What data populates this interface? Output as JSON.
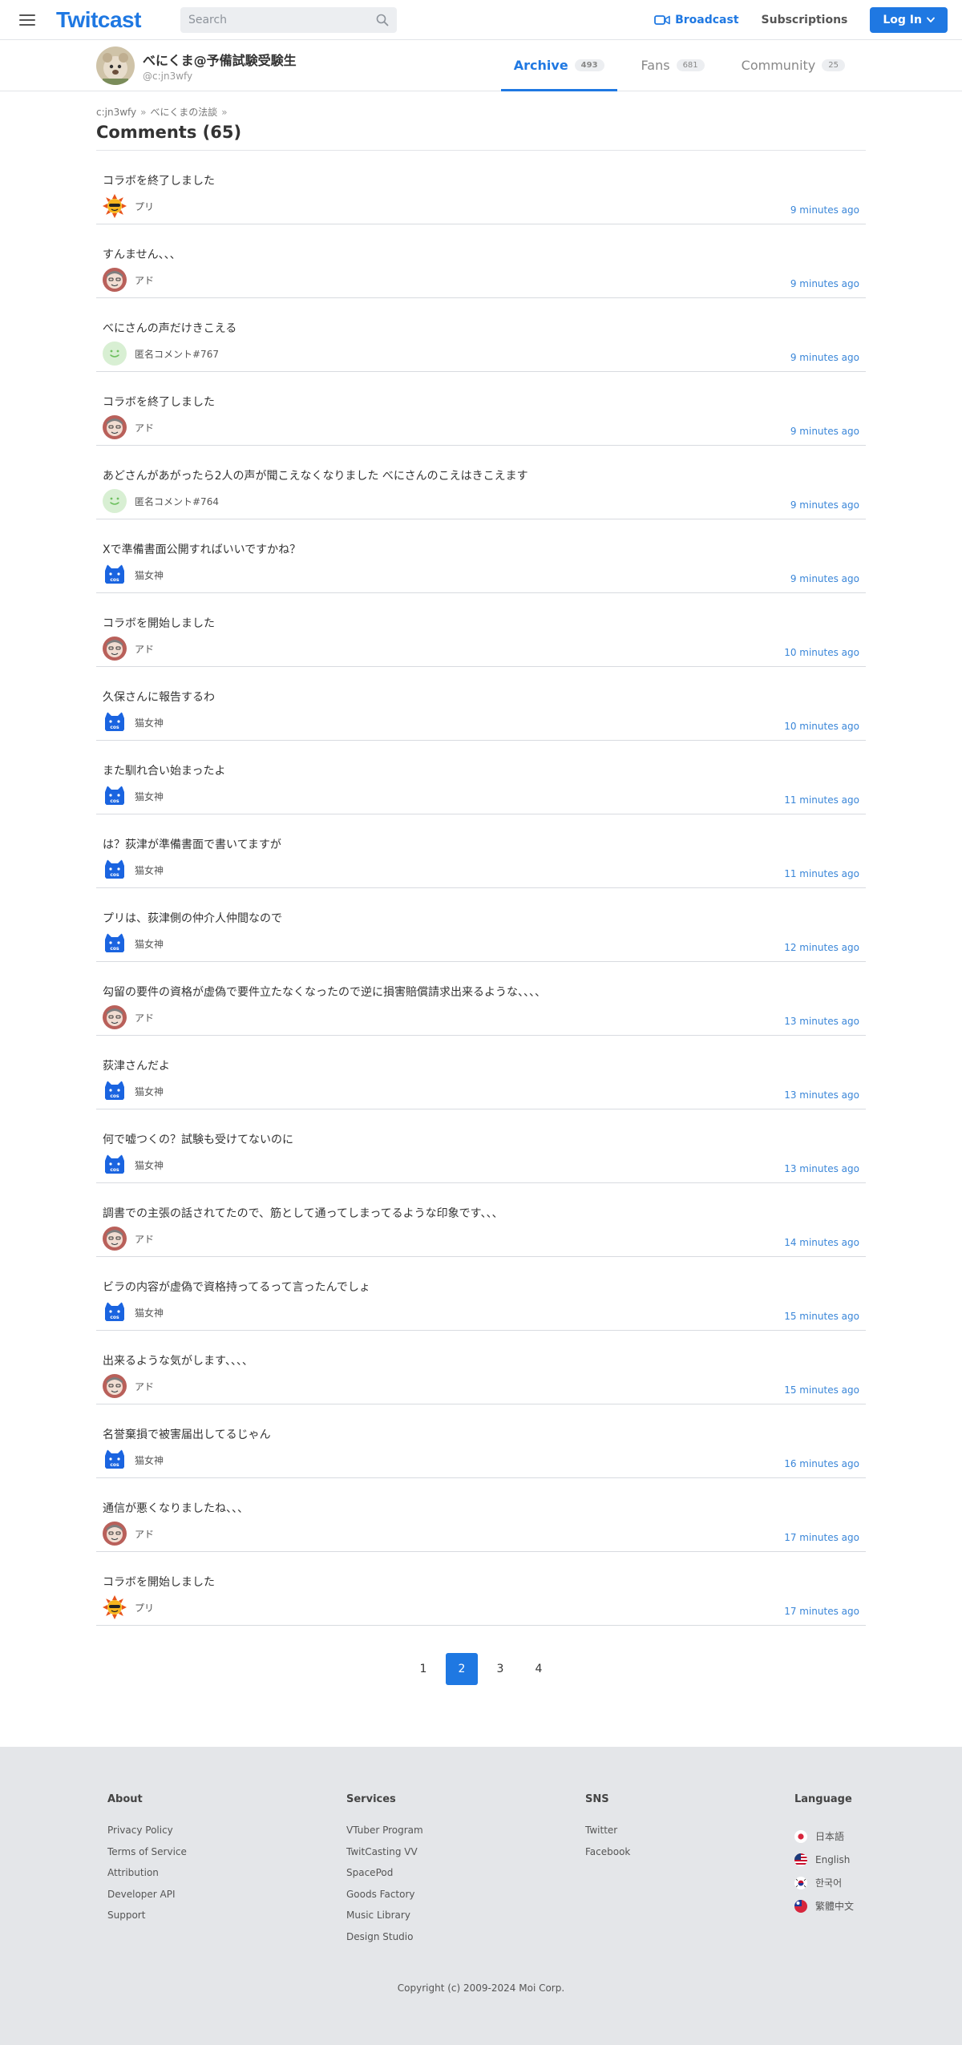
{
  "header": {
    "logo": "Twitcast",
    "search_placeholder": "Search",
    "broadcast_label": "Broadcast",
    "subscriptions_label": "Subscriptions",
    "login_label": "Log In",
    "accent_color": "#1f78e2"
  },
  "profile": {
    "name": "べにくま@予備試験受験生",
    "id": "@c:jn3wfy",
    "tabs": [
      {
        "label": "Archive",
        "count": "493",
        "active": true
      },
      {
        "label": "Fans",
        "count": "681",
        "active": false
      },
      {
        "label": "Community",
        "count": "25",
        "active": false
      }
    ]
  },
  "breadcrumb": [
    "c:jn3wfy",
    "べにくまの法談"
  ],
  "page_title": "Comments (65)",
  "comments": [
    {
      "text": "コラボを終了しました",
      "user": "プリ",
      "avatar": "sun-avatar",
      "time": "9 minutes ago"
    },
    {
      "text": "すんません、、、",
      "user": "アド",
      "avatar": "face-avatar",
      "time": "9 minutes ago"
    },
    {
      "text": "べにさんの声だけきこえる",
      "user": "匿名コメント#767",
      "avatar": "anon-avatar",
      "time": "9 minutes ago"
    },
    {
      "text": "コラボを終了しました",
      "user": "アド",
      "avatar": "face-avatar",
      "time": "9 minutes ago"
    },
    {
      "text": "あどさんがあがったら2人の声が聞こえなくなりました べにさんのこえはきこえます",
      "user": "匿名コメント#764",
      "avatar": "anon-avatar",
      "time": "9 minutes ago"
    },
    {
      "text": "Xで準備書面公開すればいいですかね？",
      "user": "猫女神",
      "avatar": "cat-avatar",
      "time": "9 minutes ago"
    },
    {
      "text": "コラボを開始しました",
      "user": "アド",
      "avatar": "face-avatar",
      "time": "10 minutes ago"
    },
    {
      "text": "久保さんに報告するわ",
      "user": "猫女神",
      "avatar": "cat-avatar",
      "time": "10 minutes ago"
    },
    {
      "text": "また馴れ合い始まったよ",
      "user": "猫女神",
      "avatar": "cat-avatar",
      "time": "11 minutes ago"
    },
    {
      "text": "は？荻津が準備書面で書いてますが",
      "user": "猫女神",
      "avatar": "cat-avatar",
      "time": "11 minutes ago"
    },
    {
      "text": "プリは、荻津側の仲介人仲間なので",
      "user": "猫女神",
      "avatar": "cat-avatar",
      "time": "12 minutes ago"
    },
    {
      "text": "勾留の要件の資格が虚偽で要件立たなくなったので逆に損害賠償請求出来るような、、、、",
      "user": "アド",
      "avatar": "face-avatar",
      "time": "13 minutes ago"
    },
    {
      "text": "荻津さんだよ",
      "user": "猫女神",
      "avatar": "cat-avatar",
      "time": "13 minutes ago"
    },
    {
      "text": "何で嘘つくの？試験も受けてないのに",
      "user": "猫女神",
      "avatar": "cat-avatar",
      "time": "13 minutes ago"
    },
    {
      "text": "調書での主張の話されてたので、筋として通ってしまってるような印象です、、、",
      "user": "アド",
      "avatar": "face-avatar",
      "time": "14 minutes ago"
    },
    {
      "text": "ビラの内容が虚偽で資格持ってるって言ったんでしょ",
      "user": "猫女神",
      "avatar": "cat-avatar",
      "time": "15 minutes ago"
    },
    {
      "text": "出来るような気がします、、、、",
      "user": "アド",
      "avatar": "face-avatar",
      "time": "15 minutes ago"
    },
    {
      "text": "名誉棄損で被害届出してるじゃん",
      "user": "猫女神",
      "avatar": "cat-avatar",
      "time": "16 minutes ago"
    },
    {
      "text": "通信が悪くなりましたね、、、",
      "user": "アド",
      "avatar": "face-avatar",
      "time": "17 minutes ago"
    },
    {
      "text": "コラボを開始しました",
      "user": "プリ",
      "avatar": "sun-avatar",
      "time": "17 minutes ago"
    }
  ],
  "pagination": [
    {
      "label": "1",
      "active": false
    },
    {
      "label": "2",
      "active": true
    },
    {
      "label": "3",
      "active": false
    },
    {
      "label": "4",
      "active": false
    }
  ],
  "footer": {
    "about": {
      "heading": "About",
      "links": [
        "Privacy Policy",
        "Terms of Service",
        "Attribution",
        "Developer API",
        "Support"
      ]
    },
    "services": {
      "heading": "Services",
      "links": [
        "VTuber Program",
        "TwitCasting VV",
        "SpacePod",
        "Goods Factory",
        "Music Library",
        "Design Studio"
      ]
    },
    "sns": {
      "heading": "SNS",
      "links": [
        "Twitter",
        "Facebook"
      ]
    },
    "language": {
      "heading": "Language",
      "links": [
        {
          "label": "日本語",
          "flag": "japan-flag-icon"
        },
        {
          "label": "English",
          "flag": "us-flag-icon"
        },
        {
          "label": "한국어",
          "flag": "korea-flag-icon"
        },
        {
          "label": "繁體中文",
          "flag": "taiwan-flag-icon"
        }
      ]
    },
    "copyright": "Copyright (c) 2009-2024 Moi Corp."
  }
}
